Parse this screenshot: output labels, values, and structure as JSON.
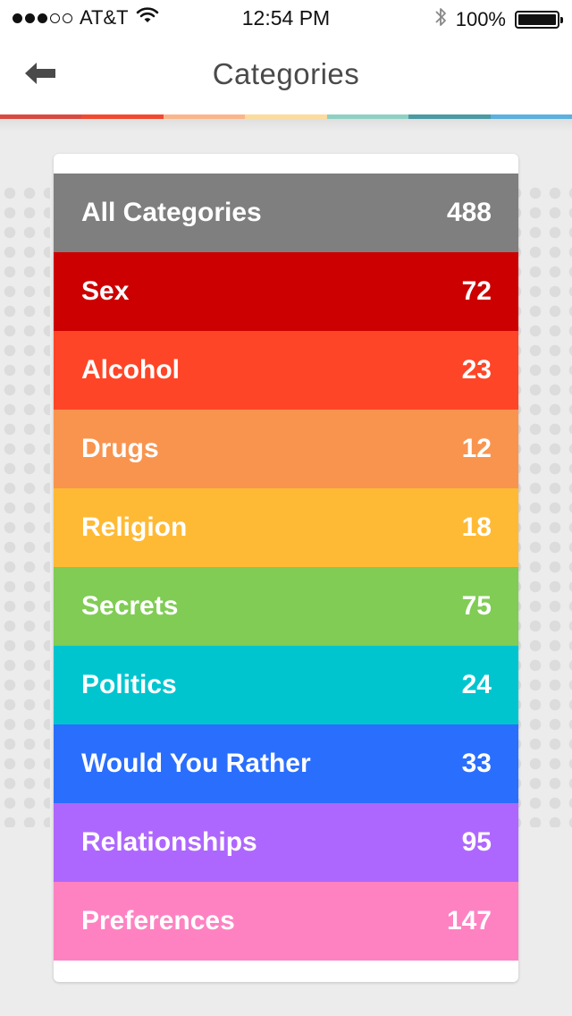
{
  "status_bar": {
    "carrier": "AT&T",
    "time": "12:54 PM",
    "battery": "100%",
    "signal_total": 5,
    "signal_filled": 3,
    "battery_level": 1.0,
    "icons": [
      "wifi-icon",
      "bluetooth-icon",
      "battery-icon"
    ]
  },
  "nav": {
    "title": "Categories",
    "back_icon": "arrow-left-icon"
  },
  "stripe_colors": [
    "#d84b40",
    "#f14a31",
    "#fbb58a",
    "#fcdb9c",
    "#8ed1c4",
    "#4c9aa3",
    "#5cb0de"
  ],
  "categories": [
    {
      "name": "All Categories",
      "count": "488",
      "color": "#7f7f7f"
    },
    {
      "name": "Sex",
      "count": "72",
      "color": "#cc0000"
    },
    {
      "name": "Alcohol",
      "count": "23",
      "color": "#ff4527"
    },
    {
      "name": "Drugs",
      "count": "12",
      "color": "#f9944f"
    },
    {
      "name": "Religion",
      "count": "18",
      "color": "#ffba35"
    },
    {
      "name": "Secrets",
      "count": "75",
      "color": "#80cc55"
    },
    {
      "name": "Politics",
      "count": "24",
      "color": "#00c5cf"
    },
    {
      "name": "Would You Rather",
      "count": "33",
      "color": "#2a6efe"
    },
    {
      "name": "Relationships",
      "count": "95",
      "color": "#ae67fe"
    },
    {
      "name": "Preferences",
      "count": "147",
      "color": "#fe82c1"
    }
  ]
}
